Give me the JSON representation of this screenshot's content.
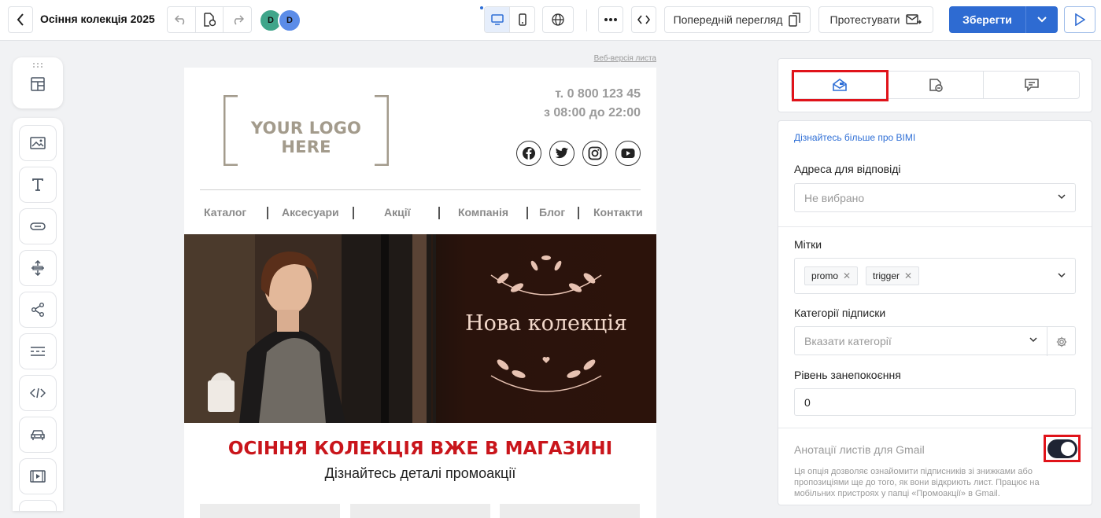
{
  "topbar": {
    "title": "Осіння колекція 2025",
    "avatars": [
      "D",
      "D"
    ],
    "preview_label": "Попередній перегляд",
    "test_label": "Протестувати",
    "save_label": "Зберегти"
  },
  "canvas": {
    "web_version_label": "Веб-версія листа",
    "logo_text": "YOUR LOGO HERE",
    "phone": "т. 0 800 123 45",
    "hours": "з 08:00 до 22:00",
    "social_icons": [
      "facebook-icon",
      "twitter-icon",
      "instagram-icon",
      "youtube-icon"
    ],
    "nav": [
      "Каталог",
      "Аксесуари",
      "Акції",
      "Компанія",
      "Блог",
      "Контакти"
    ],
    "hero_title": "Нова колекція",
    "headline": "ОСІННЯ КОЛЕКЦІЯ ВЖЕ В МАГАЗИНІ",
    "subheadline": "Дізнайтесь деталі промоакції"
  },
  "panel": {
    "tabs": [
      "envelope-icon",
      "ad-icon",
      "comment-icon"
    ],
    "active_tab": 0,
    "bimi_link": "Дізнайтесь більше про BIMI",
    "reply_label": "Адреса для відповіді",
    "reply_value": "Не вибрано",
    "tags_label": "Мітки",
    "tags": [
      "promo",
      "trigger"
    ],
    "categories_label": "Категорії підписки",
    "categories_placeholder": "Вказати категорії",
    "concern_label": "Рівень занепокоєння",
    "concern_value": "0",
    "gmail_label": "Анотації листів для Gmail",
    "gmail_enabled": true,
    "gmail_desc": "Ця опція дозволяє ознайомити підписників зі знижками або пропозиціями ще до того, як вони відкриють лист. Працює на мобільних пристроях у папці «Промоакції» в Gmail."
  },
  "colors": {
    "accent": "#2e6bd2",
    "headline": "#c9151b",
    "highlight": "#e0131a"
  }
}
